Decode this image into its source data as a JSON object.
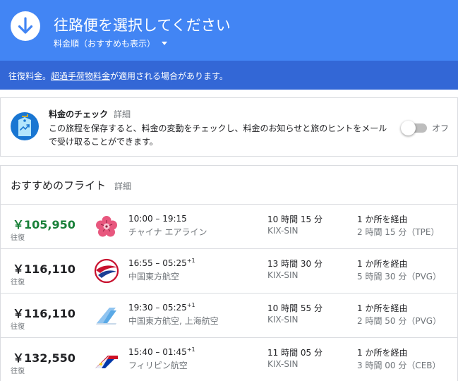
{
  "header": {
    "title": "往路便を選択してください",
    "sort_label": "料金順（おすすめも表示）",
    "bg_color": "#4285f4"
  },
  "notice": {
    "prefix": "往復料金。",
    "link": "超過手荷物料金",
    "suffix": "が適用される場合があります。"
  },
  "price_tracking": {
    "title": "料金のチェック",
    "detail_link": "詳細",
    "description": "この旅程を保存すると、料金の変動をチェックし、料金のお知らせと旅のヒントをメールで受け取ることができます。",
    "toggle_label": "オフ",
    "toggle_on": false
  },
  "flights": {
    "heading": "おすすめのフライト",
    "detail_link": "詳細",
    "items": [
      {
        "price": "￥105,950",
        "trip_type": "往復",
        "depart": "10:00",
        "arrive": "19:15",
        "day_offset": "",
        "airline": "チャイナ エアライン",
        "duration": "10 時間 15 分",
        "route": "KIX-SIN",
        "stops": "1 か所を経由",
        "layover": "2 時間 15 分（TPE）",
        "logo": "china-airlines-plum-blossom"
      },
      {
        "price": "￥116,110",
        "trip_type": "往復",
        "depart": "16:55",
        "arrive": "05:25",
        "day_offset": "+1",
        "airline": "中国東方航空",
        "duration": "13 時間 30 分",
        "route": "KIX-SIN",
        "stops": "1 か所を経由",
        "layover": "5 時間 30 分（PVG）",
        "logo": "china-eastern-swallow"
      },
      {
        "price": "￥116,110",
        "trip_type": "往復",
        "depart": "19:30",
        "arrive": "05:25",
        "day_offset": "+1",
        "airline": "中国東方航空, 上海航空",
        "duration": "10 時間 55 分",
        "route": "KIX-SIN",
        "stops": "1 か所を経由",
        "layover": "2 時間 50 分（PVG）",
        "logo": "multi-airline-wing"
      },
      {
        "price": "￥132,550",
        "trip_type": "往復",
        "depart": "15:40",
        "arrive": "01:45",
        "day_offset": "+1",
        "airline": "フィリピン航空",
        "duration": "11 時間 05 分",
        "route": "KIX-SIN",
        "stops": "1 か所を経由",
        "layover": "3 時間 00 分（CEB）",
        "logo": "philippine-airlines-flag"
      }
    ]
  }
}
